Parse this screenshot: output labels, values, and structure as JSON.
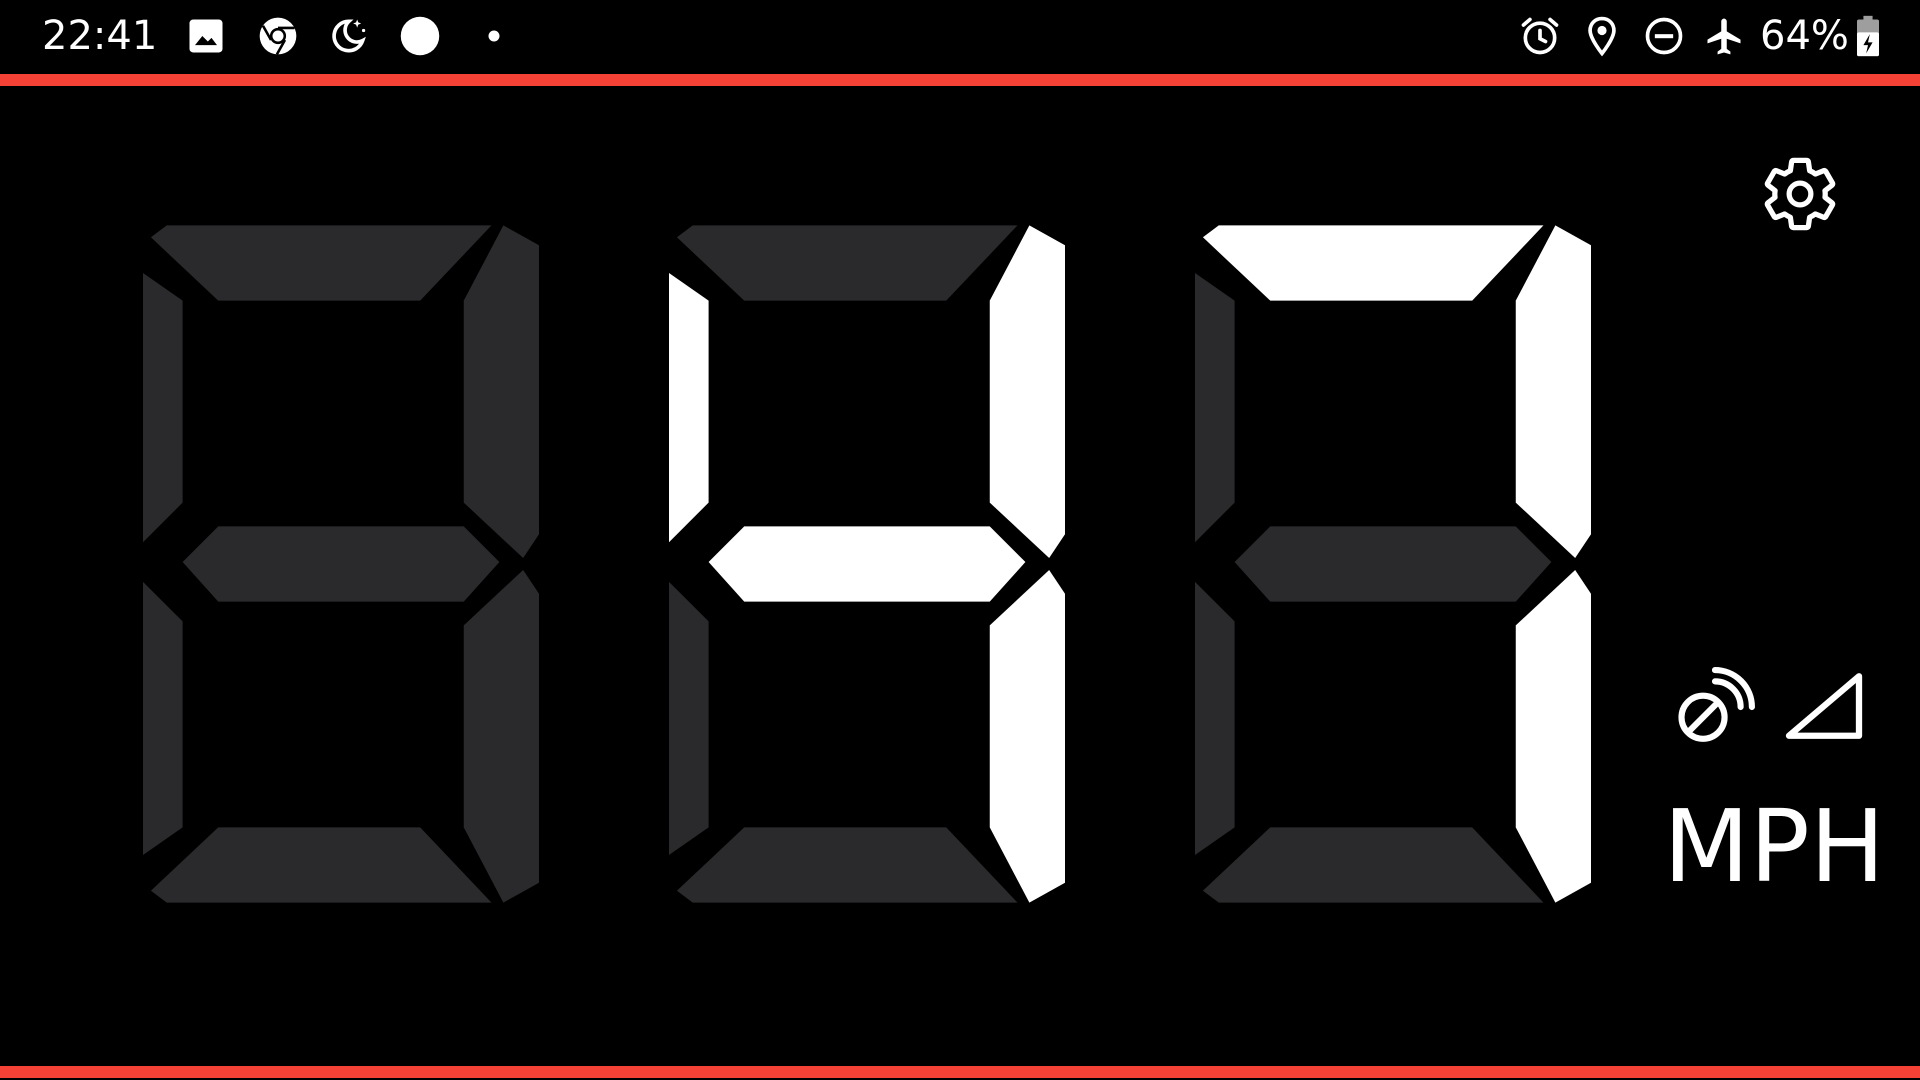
{
  "status_bar": {
    "time": "22:41",
    "battery_percent": "64%",
    "left_icons": [
      "gallery-icon",
      "chrome-icon",
      "bedtime-icon",
      "circle-icon",
      "dot-icon"
    ],
    "right_icons": [
      "alarm-icon",
      "location-icon",
      "dnd-icon",
      "airplane-icon",
      "battery-charging-icon"
    ]
  },
  "speedometer": {
    "speed": "47",
    "digits": [
      "",
      "4",
      "7"
    ],
    "unit": "MPH"
  },
  "colors": {
    "accent": "#f44336",
    "segment_on": "#ffffff",
    "segment_off": "#2a2a2c",
    "background": "#000000"
  }
}
